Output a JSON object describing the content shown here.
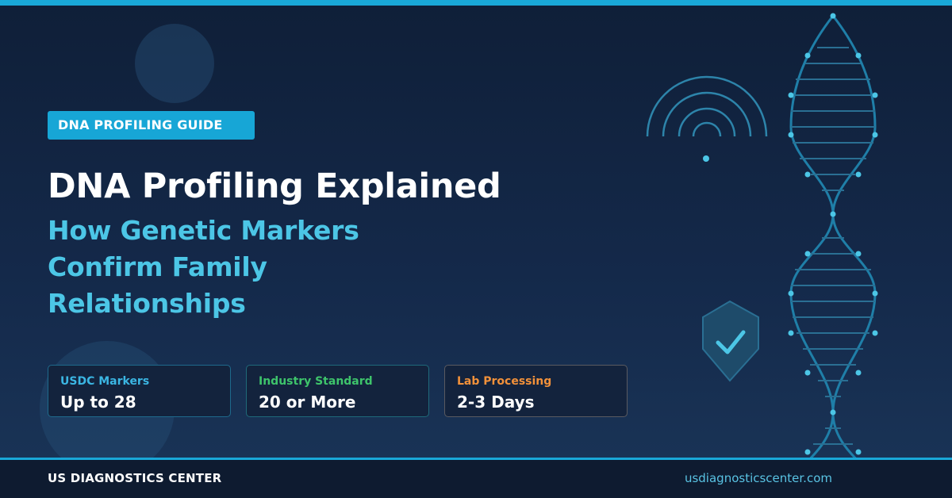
{
  "tag_label": "DNA PROFILING GUIDE",
  "headline": "DNA Profiling Explained",
  "subheadline_lines": [
    "How Genetic Markers",
    "Confirm Family",
    "Relationships"
  ],
  "stats": [
    {
      "label": "USDC Markers",
      "value": "Up to 28",
      "label_color": "#3bb6e3"
    },
    {
      "label": "Industry Standard",
      "value": "20 or More",
      "label_color": "#3ec46b"
    },
    {
      "label": "Lab Processing",
      "value": "2-3 Days",
      "label_color": "#f2913a"
    }
  ],
  "footer": {
    "brand": "US DIAGNOSTICS CENTER",
    "url": "usdiagnosticscenter.com"
  },
  "icons": [
    "wifi-signal-icon",
    "shield-check-icon",
    "dna-helix-icon"
  ],
  "colors": {
    "accent": "#19a8d8",
    "subheadline": "#4cc6e6",
    "background_top": "#0f1f38",
    "background_bottom": "#1a3558"
  }
}
